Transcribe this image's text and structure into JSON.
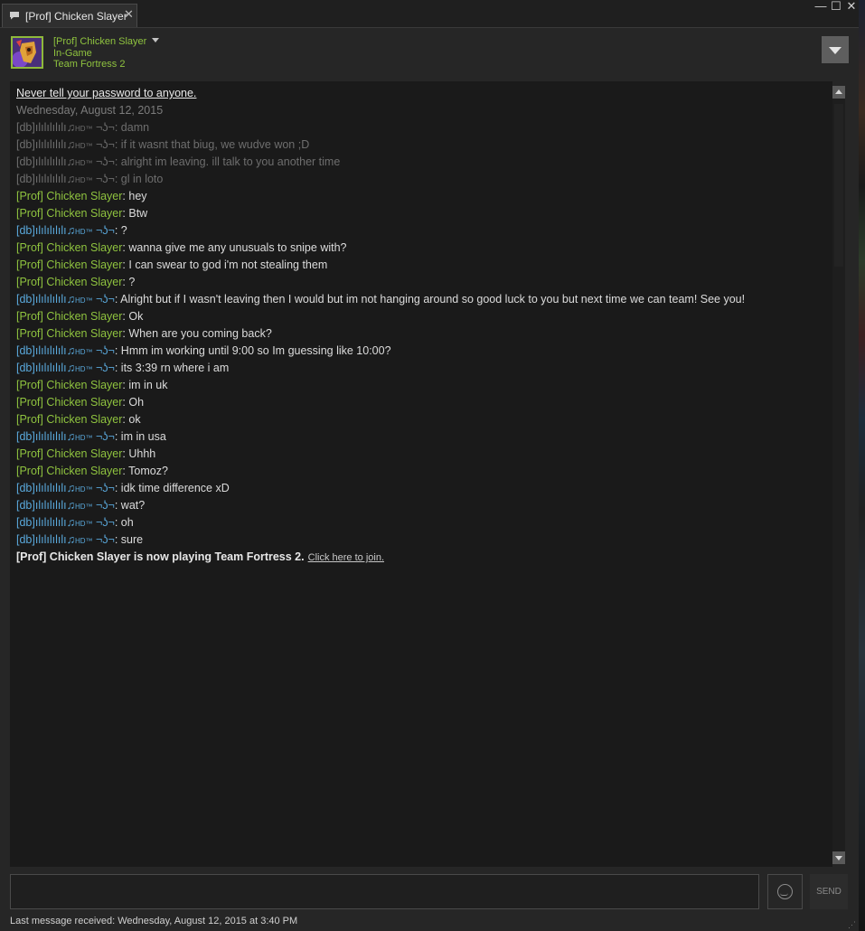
{
  "window": {
    "tab_title": "[Prof] Chicken Slayer",
    "close_glyph": "✕",
    "minimize_glyph": "—",
    "maximize_glyph": "☐",
    "window_close_glyph": "✕"
  },
  "friend": {
    "name": "[Prof] Chicken Slayer",
    "status": "In-Game",
    "game": "Team Fortress 2",
    "name_color": "#8fc33f"
  },
  "chat": {
    "warning": "Never tell your password to anyone.",
    "date": "Wednesday, August 12, 2015",
    "other_name_prefix": "[db]ılılılılılı♫",
    "other_name_hd": "HD™",
    "other_name_suffix": " ¬ʖ¬",
    "my_name": "[Prof] Chicken Slayer",
    "colors": {
      "me": "#8fc33f",
      "them": "#5aa9dc",
      "old": "#6e6e6e"
    },
    "messages": [
      {
        "from": "them",
        "old": true,
        "text": "damn"
      },
      {
        "from": "them",
        "old": true,
        "text": "if it wasnt that biug, we wudve won ;D"
      },
      {
        "from": "them",
        "old": true,
        "text": "alright im leaving. ill talk to you another time"
      },
      {
        "from": "them",
        "old": true,
        "text": "gl in loto"
      },
      {
        "from": "me",
        "text": "hey"
      },
      {
        "from": "me",
        "text": "Btw"
      },
      {
        "from": "them",
        "text": "?"
      },
      {
        "from": "me",
        "text": "wanna give me any unusuals to snipe with?"
      },
      {
        "from": "me",
        "text": "I can swear to god i'm not stealing them"
      },
      {
        "from": "me",
        "text": "?"
      },
      {
        "from": "them",
        "text": "Alright but if I wasn't leaving then I would but im not hanging around so good luck to you but next time we can team! See you!"
      },
      {
        "from": "me",
        "text": "Ok"
      },
      {
        "from": "me",
        "text": "When are you coming back?"
      },
      {
        "from": "them",
        "text": "Hmm im working until 9:00 so Im guessing like 10:00?"
      },
      {
        "from": "them",
        "text": "its 3:39 rn where i am"
      },
      {
        "from": "me",
        "text": "im in uk"
      },
      {
        "from": "me",
        "text": "Oh"
      },
      {
        "from": "me",
        "text": "ok"
      },
      {
        "from": "them",
        "text": "im in usa"
      },
      {
        "from": "me",
        "text": "Uhhh"
      },
      {
        "from": "me",
        "text": "Tomoz?"
      },
      {
        "from": "them",
        "text": "idk time difference xD"
      },
      {
        "from": "them",
        "text": "wat?"
      },
      {
        "from": "them",
        "text": "oh"
      },
      {
        "from": "them",
        "text": "sure"
      }
    ],
    "system_message": "[Prof] Chicken Slayer is now playing Team Fortress 2.",
    "join_link": "Click here to join."
  },
  "input": {
    "value": "",
    "placeholder": "",
    "send_label": "SEND"
  },
  "footer": {
    "last_message": "Last message received: Wednesday, August 12, 2015 at 3:40 PM"
  },
  "icons": {
    "tab": "chat-bubble-icon",
    "emoticon": "smiley-face-icon",
    "header_menu": "chevron-down-icon",
    "resize": "resize-grip-icon"
  }
}
